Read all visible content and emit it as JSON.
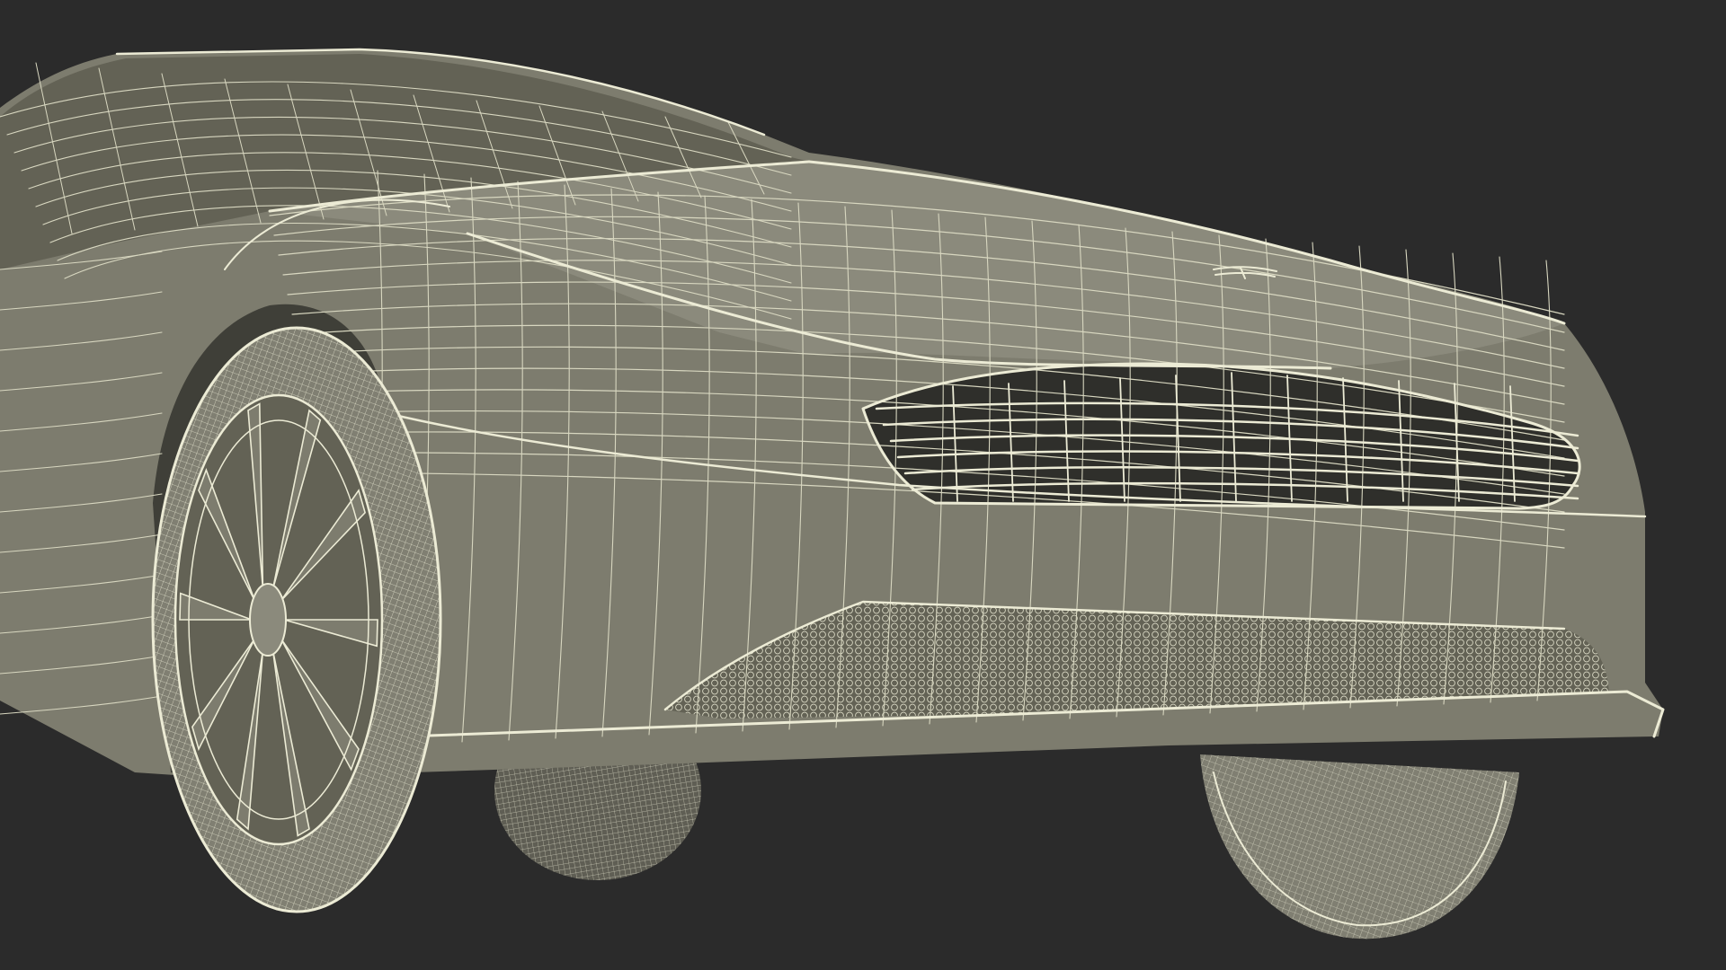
{
  "scene": {
    "subject": "sports-car-wireframe",
    "view": "front-three-quarter-close-up"
  },
  "colors": {
    "background": "#2b2b2b",
    "body_fill": "#7d7c6e",
    "body_fill_light": "#8b8a7c",
    "body_fill_dark": "#636255",
    "shadow": "#3f3f38",
    "wire": "#ecebd5",
    "wire_soft": "#d8d7c0",
    "tire": "#807f72",
    "tire_dark": "#5f5e54",
    "grille_dark": "#2f2f2b"
  }
}
